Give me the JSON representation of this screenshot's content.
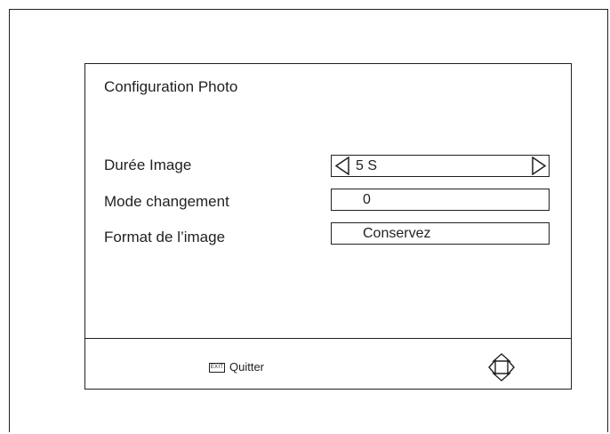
{
  "menu": {
    "title": "Configuration Photo",
    "rows": [
      {
        "label": "Durée Image",
        "value": "5 S",
        "has_arrows": true
      },
      {
        "label": "Mode changement",
        "value": "0",
        "has_arrows": false
      },
      {
        "label": "Format de l’image",
        "value": "Conservez",
        "has_arrows": false
      }
    ]
  },
  "footer": {
    "exit_key": "EXIT",
    "quit_label": "Quitter",
    "nav_icon": "dpad-icon"
  },
  "colors": {
    "line": "#231f20",
    "background": "#ffffff"
  }
}
